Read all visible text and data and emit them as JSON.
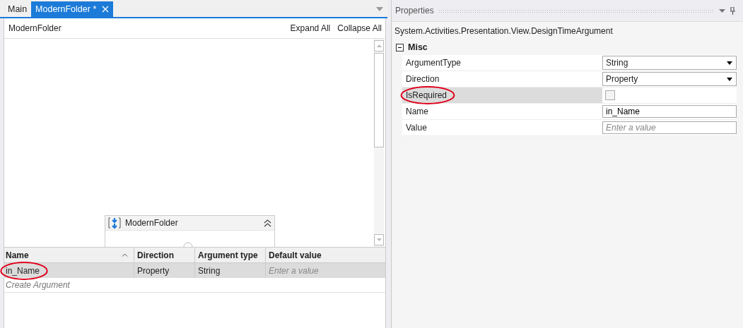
{
  "tabs": [
    {
      "label": "Main",
      "selected": false,
      "closable": false
    },
    {
      "label": "ModernFolder *",
      "selected": true,
      "closable": true
    }
  ],
  "designer": {
    "breadcrumb": "ModernFolder",
    "actions": [
      "Expand All",
      "Collapse All"
    ],
    "activity": {
      "title": "ModernFolder"
    }
  },
  "arguments": {
    "columns": [
      {
        "label": "Name",
        "sorted": true
      },
      {
        "label": "Direction",
        "sorted": false
      },
      {
        "label": "Argument type",
        "sorted": false
      },
      {
        "label": "Default value",
        "sorted": false
      }
    ],
    "rows": [
      {
        "name": "in_Name",
        "direction": "Property",
        "type": "String",
        "default_placeholder": "Enter a value",
        "selected": true,
        "circled": true
      }
    ],
    "create_label": "Create Argument"
  },
  "properties": {
    "title": "Properties",
    "type_name": "System.Activities.Presentation.View.DesignTimeArgument",
    "category": {
      "label": "Misc",
      "expanded": true
    },
    "rows": [
      {
        "label": "ArgumentType",
        "kind": "dropdown",
        "value": "String",
        "selected": false,
        "circled": false
      },
      {
        "label": "Direction",
        "kind": "dropdown",
        "value": "Property",
        "selected": false,
        "circled": false
      },
      {
        "label": "IsRequired",
        "kind": "checkbox",
        "checked": false,
        "selected": true,
        "circled": true
      },
      {
        "label": "Name",
        "kind": "text",
        "value": "in_Name",
        "selected": false,
        "circled": false
      },
      {
        "label": "Value",
        "kind": "text",
        "placeholder": "Enter a value",
        "selected": false,
        "circled": false
      }
    ]
  }
}
